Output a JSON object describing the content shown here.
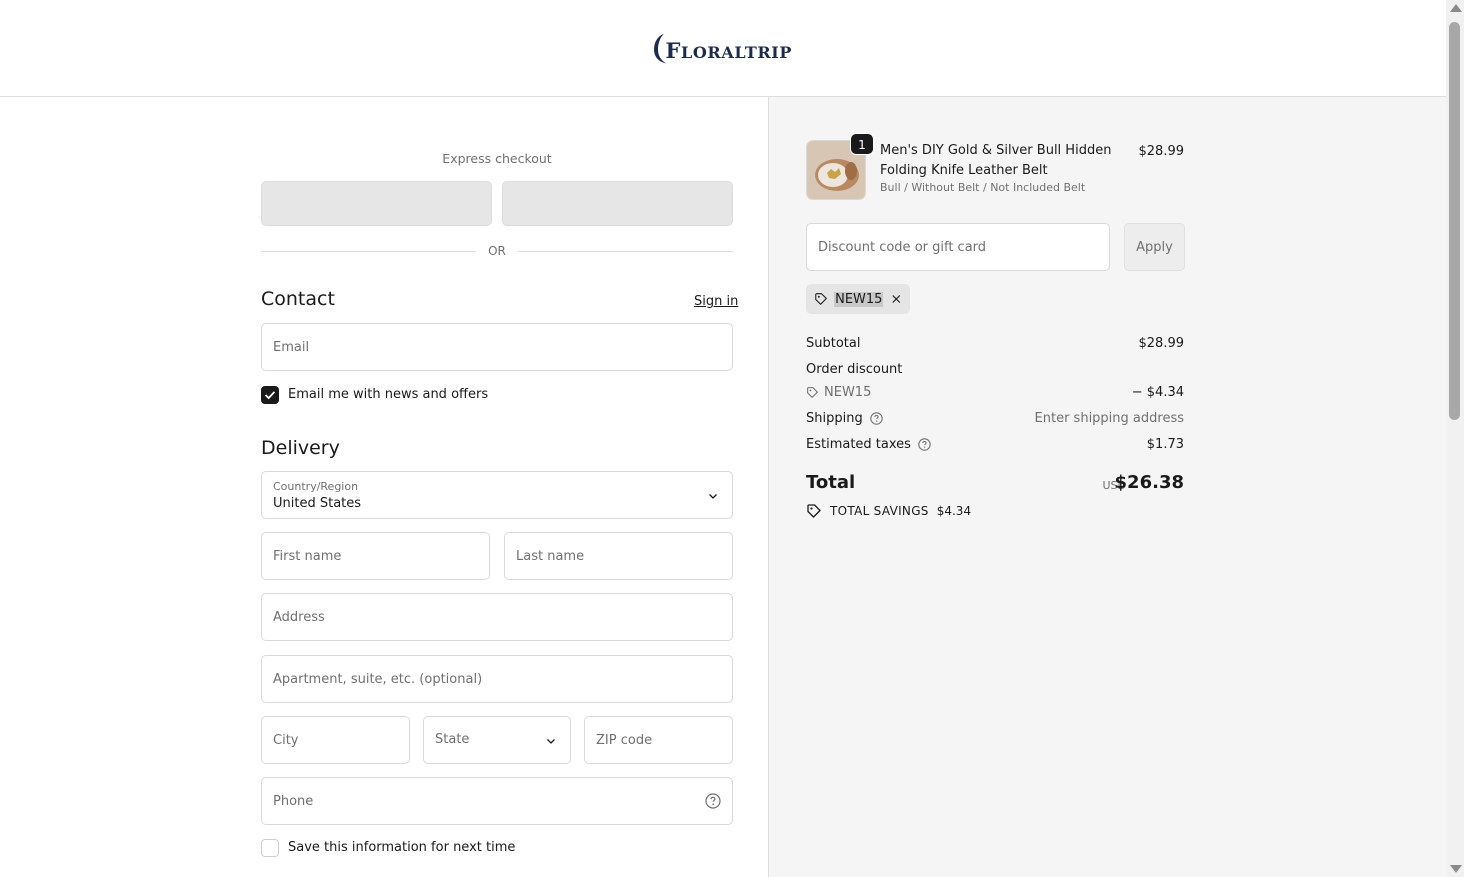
{
  "header": {
    "logo_text_initial": "F",
    "logo_text_rest": "LORALTRIP"
  },
  "express": {
    "title": "Express checkout",
    "or_label": "OR"
  },
  "contact": {
    "heading": "Contact",
    "signin_label": "Sign in",
    "email_placeholder": "Email",
    "newsletter_label": "Email me with news and offers",
    "newsletter_checked": true
  },
  "delivery": {
    "heading": "Delivery",
    "country_label": "Country/Region",
    "country_value": "United States",
    "first_name_placeholder": "First name",
    "last_name_placeholder": "Last name",
    "address_placeholder": "Address",
    "apartment_placeholder": "Apartment, suite, etc. (optional)",
    "city_placeholder": "City",
    "state_placeholder": "State",
    "zip_placeholder": "ZIP code",
    "phone_placeholder": "Phone",
    "save_info_label": "Save this information for next time",
    "save_info_checked": false
  },
  "summary": {
    "product": {
      "quantity": "1",
      "name": "Men's DIY Gold & Silver Bull Hidden Folding Knife Leather Belt",
      "variant": "Bull / Without Belt / Not Included Belt",
      "price": "$28.99"
    },
    "discount_placeholder": "Discount code or gift card",
    "apply_label": "Apply",
    "applied_code": "NEW15",
    "subtotal_label": "Subtotal",
    "subtotal_value": "$28.99",
    "order_discount_label": "Order discount",
    "discount_code": "NEW15",
    "discount_value": "− $4.34",
    "shipping_label": "Shipping",
    "shipping_value": "Enter shipping address",
    "taxes_label": "Estimated taxes",
    "taxes_value": "$1.73",
    "total_label": "Total",
    "total_currency": "USD",
    "total_value": "$26.38",
    "savings_label": "TOTAL SAVINGS",
    "savings_value": "$4.34"
  },
  "colors": {
    "accent": "#1a1a1a",
    "logo_navy": "#1c2b4d",
    "summary_bg": "#f5f5f5",
    "express_button": "#e6e6e6"
  },
  "icons": {
    "tag": "tag-icon",
    "help": "question-circle-icon",
    "chevron": "chevron-down-icon",
    "close": "close-icon",
    "check": "check-icon"
  }
}
